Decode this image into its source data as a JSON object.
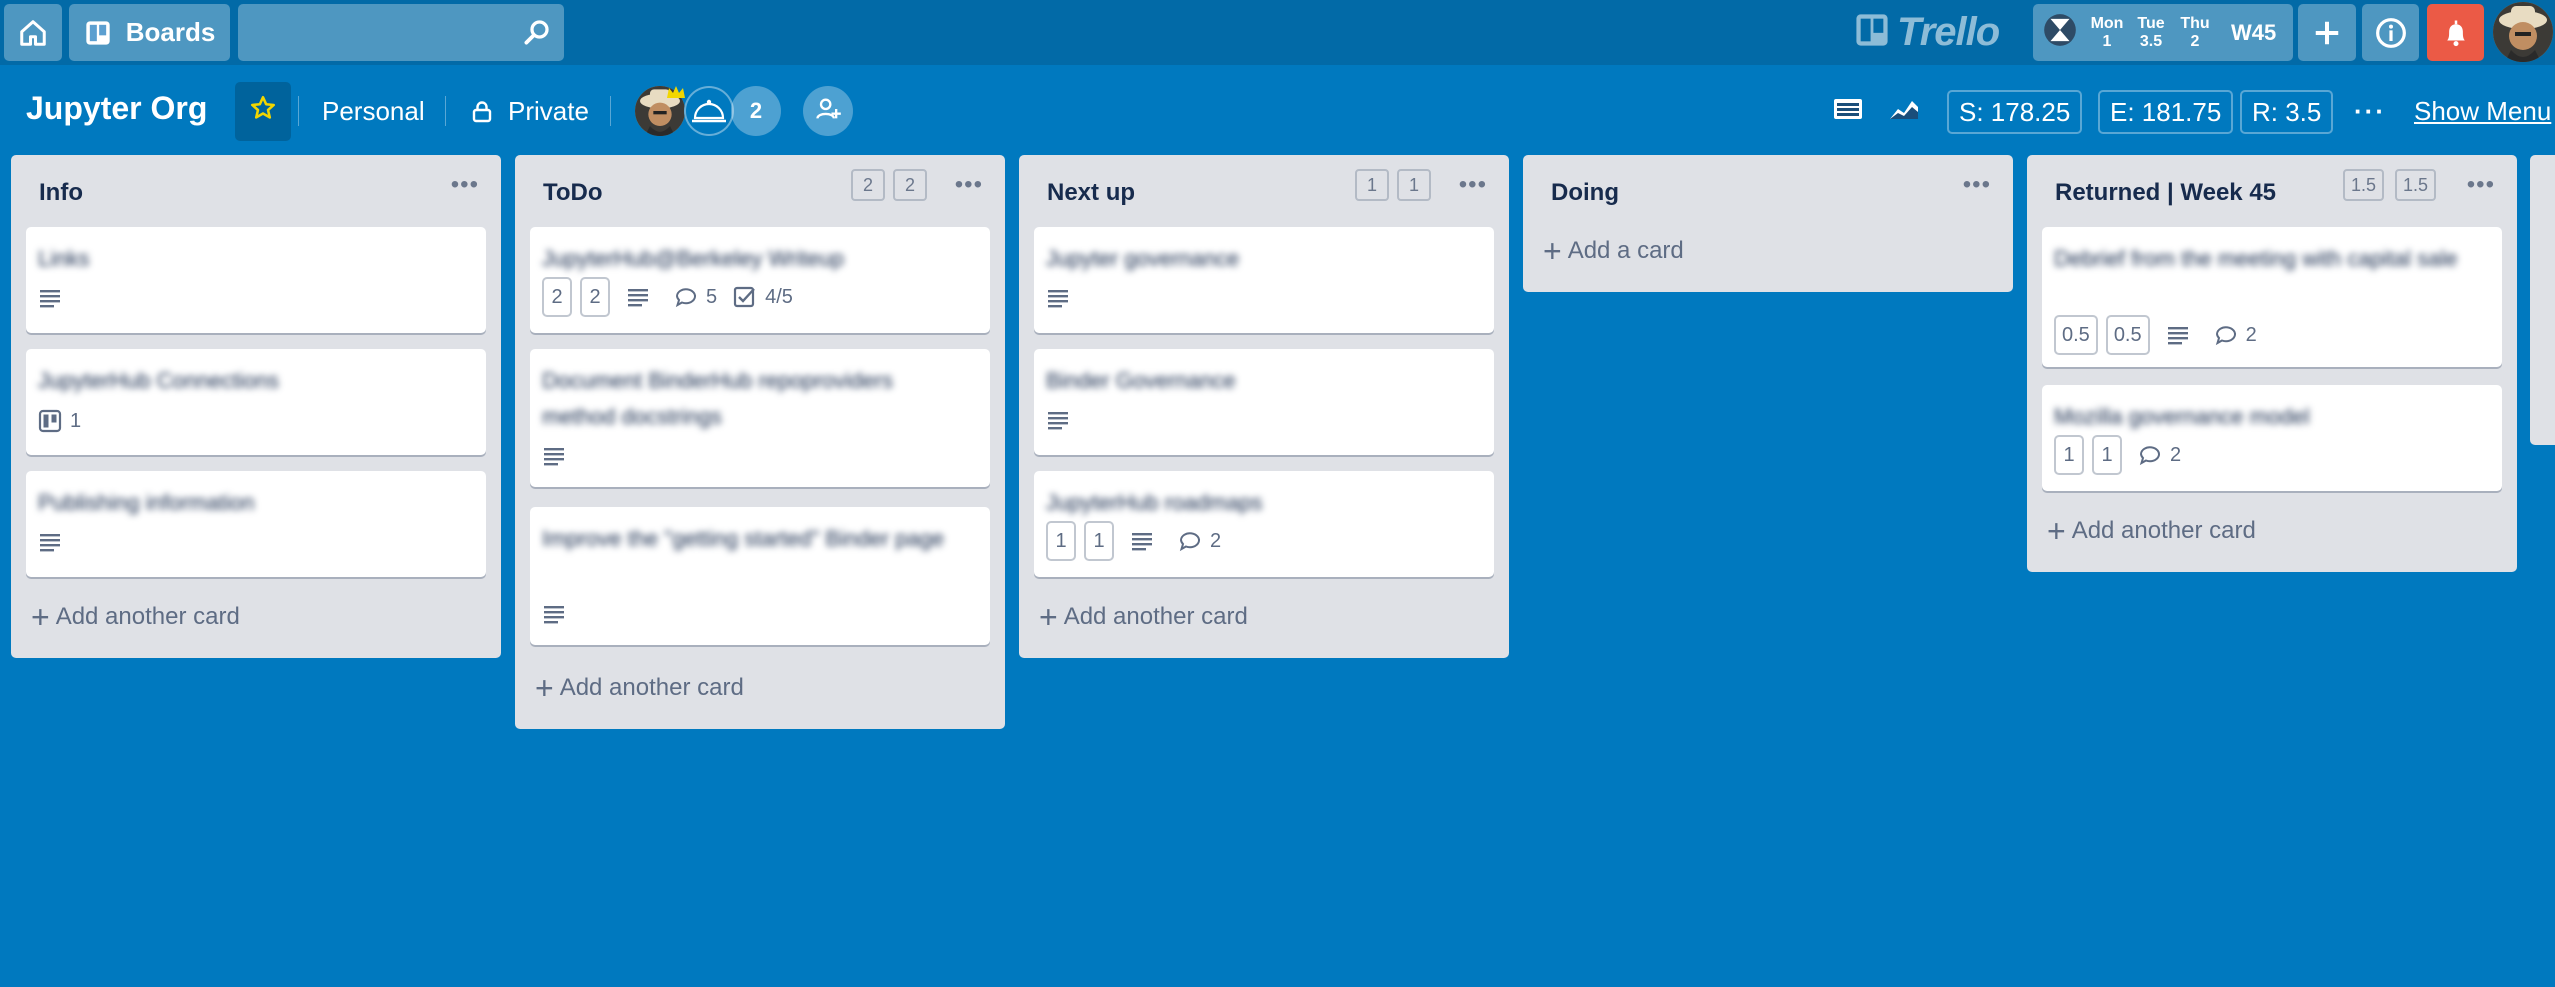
{
  "topbar": {
    "home_icon": "home-icon",
    "boards_label": "Boards",
    "search_placeholder": "",
    "search_icon": "search-icon",
    "logo_text": "Trello",
    "week": {
      "days": [
        {
          "name": "Mon",
          "value": "1"
        },
        {
          "name": "Tue",
          "value": "3.5"
        },
        {
          "name": "Thu",
          "value": "2"
        }
      ],
      "label": "W45"
    },
    "icons": [
      "plus-icon",
      "info-icon",
      "bell-icon"
    ],
    "notification_color": "#eb5a46"
  },
  "board": {
    "title": "Jupyter Org",
    "team": "Personal",
    "visibility": "Private",
    "member_count": "2",
    "stats": {
      "s": "S: 178.25",
      "e": "E: 181.75",
      "r": "R: 3.5"
    },
    "menu_dots": "···",
    "show_menu": "Show Menu",
    "background_color": "#0079bf"
  },
  "lists": [
    {
      "title": "Info",
      "pills": [],
      "cards": [
        {
          "title": "Links",
          "badges": {
            "description": true
          }
        },
        {
          "title": "JupyterHub Connections",
          "badges": {
            "board_count": "1"
          }
        },
        {
          "title": "Publishing information",
          "badges": {
            "description": true
          }
        }
      ],
      "add_label": "Add another card"
    },
    {
      "title": "ToDo",
      "pills": [
        "2",
        "2"
      ],
      "cards": [
        {
          "title": "JupyterHub@Berkeley Writeup",
          "badges": {
            "pills": [
              "2",
              "2"
            ],
            "description": true,
            "comments": "5",
            "checklist": "4/5"
          }
        },
        {
          "title": "Document BinderHub repoproviders method docstrings",
          "badges": {
            "description": true
          }
        },
        {
          "title": "Improve the \"getting started\" Binder page",
          "badges": {
            "description": true
          }
        }
      ],
      "add_label": "Add another card"
    },
    {
      "title": "Next up",
      "pills": [
        "1",
        "1"
      ],
      "cards": [
        {
          "title": "Jupyter governance",
          "badges": {
            "description": true
          }
        },
        {
          "title": "Binder Governance",
          "badges": {
            "description": true
          }
        },
        {
          "title": "JupyterHub roadmaps",
          "badges": {
            "pills": [
              "1",
              "1"
            ],
            "description": true,
            "comments": "2"
          }
        }
      ],
      "add_label": "Add another card"
    },
    {
      "title": "Doing",
      "pills": [],
      "cards": [],
      "add_label": "Add a card"
    },
    {
      "title": "Returned | Week 45",
      "pills": [
        "1.5",
        "1.5"
      ],
      "cards": [
        {
          "title": "Debrief from the meeting with capital sale",
          "badges": {
            "pills": [
              "0.5",
              "0.5"
            ],
            "description": true,
            "comments": "2"
          }
        },
        {
          "title": "Mozilla governance model",
          "badges": {
            "pills": [
              "1",
              "1"
            ],
            "comments": "2"
          }
        }
      ],
      "add_label": "Add another card"
    }
  ]
}
